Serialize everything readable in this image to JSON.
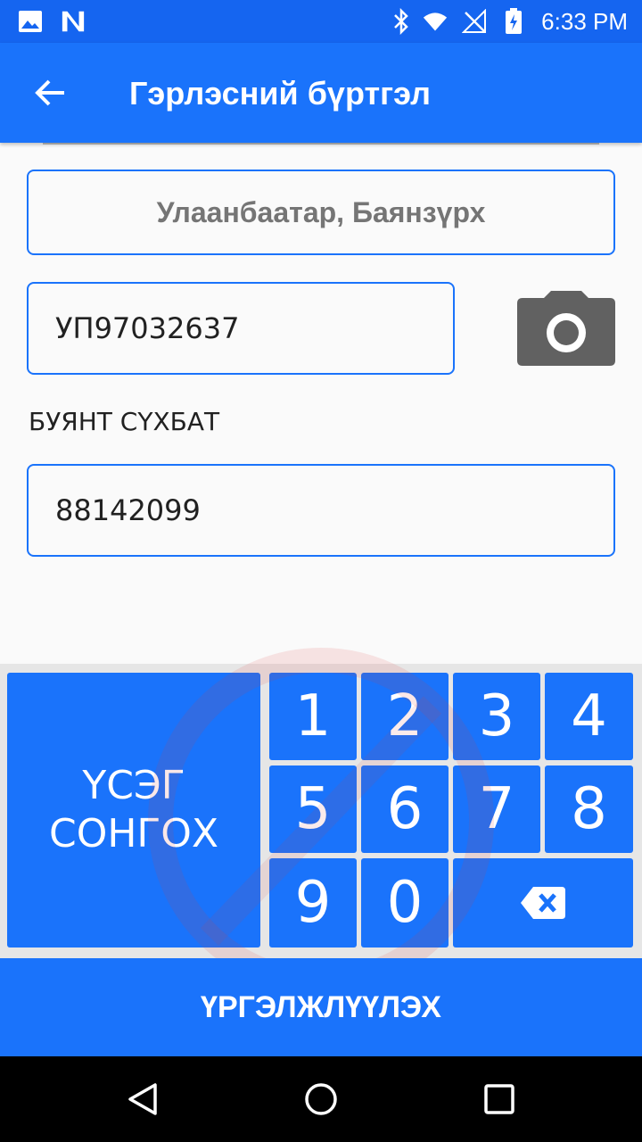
{
  "status_bar": {
    "time": "6:33 PM",
    "icons": [
      "image-icon",
      "n-icon",
      "bluetooth-icon",
      "wifi-icon",
      "no-sim-icon",
      "battery-icon"
    ]
  },
  "app_bar": {
    "title": "Гэрлэсний бүртгэл",
    "back_icon": "arrow-back-icon"
  },
  "form": {
    "location": "Улаанбаатар, Баянзүрх",
    "id_number": "УП97032637",
    "camera_icon": "camera-icon",
    "name": "БУЯНТ СҮХБАТ",
    "phone": "88142099"
  },
  "keypad": {
    "letters_line1": "ҮСЭГ",
    "letters_line2": "СОНГОХ",
    "keys": [
      "1",
      "2",
      "3",
      "4",
      "5",
      "6",
      "7",
      "8",
      "9",
      "0"
    ],
    "backspace_icon": "backspace-icon"
  },
  "continue_label": "ҮРГЭЛЖЛҮҮЛЭХ",
  "nav": [
    "back-nav-icon",
    "home-nav-icon",
    "recents-nav-icon"
  ],
  "colors": {
    "primary": "#1a73fb",
    "status": "#1565f0",
    "keypad_bg": "#e6e6e6",
    "camera": "#616161"
  }
}
